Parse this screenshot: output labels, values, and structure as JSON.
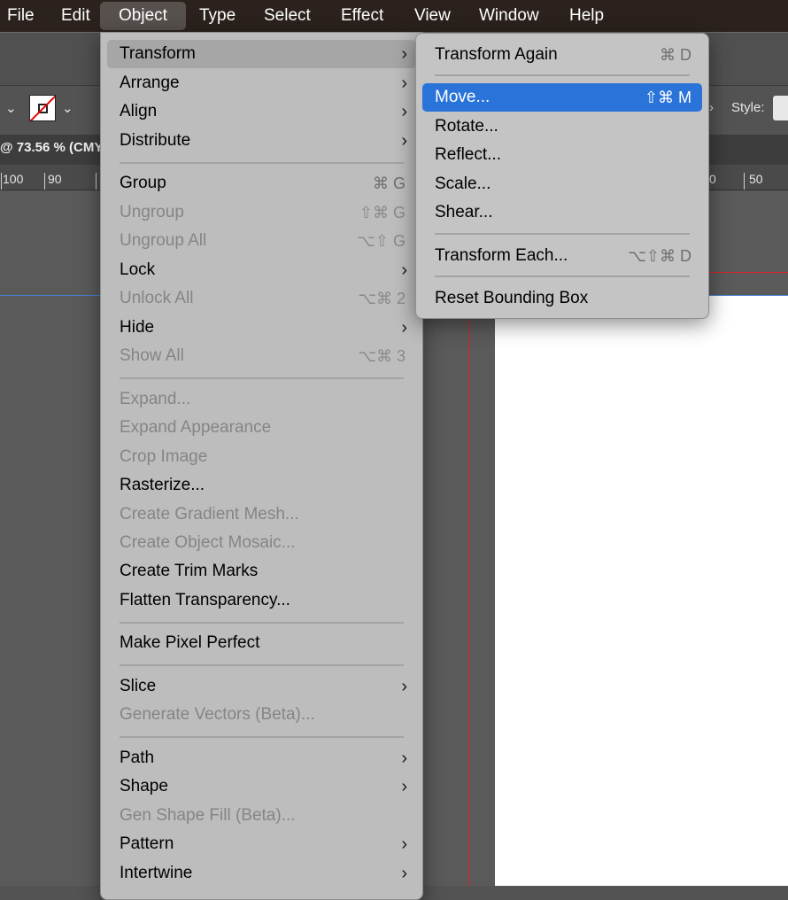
{
  "menubar": {
    "items": [
      "File",
      "Edit",
      "Object",
      "Type",
      "Select",
      "Effect",
      "View",
      "Window",
      "Help"
    ],
    "active": "Object"
  },
  "app": {
    "document_tab_title": "@ 73.56 % (CMY",
    "style_label": "Style:",
    "ruler": [
      "100",
      "90",
      "0",
      "50"
    ],
    "guide_color": "#e0202a",
    "highlight_color": "#2a73d9"
  },
  "object_menu": {
    "items": [
      {
        "label": "Transform",
        "submenu": true,
        "state": "hover"
      },
      {
        "label": "Arrange",
        "submenu": true
      },
      {
        "label": "Align",
        "submenu": true
      },
      {
        "label": "Distribute",
        "submenu": true
      },
      {
        "label": "Group",
        "shortcut": "⌘ G"
      },
      {
        "label": "Ungroup",
        "shortcut": "⇧⌘ G",
        "disabled": true
      },
      {
        "label": "Ungroup All",
        "shortcut": "⌥⇧ G",
        "disabled": true
      },
      {
        "label": "Lock",
        "submenu": true
      },
      {
        "label": "Unlock All",
        "shortcut": "⌥⌘ 2",
        "disabled": true
      },
      {
        "label": "Hide",
        "submenu": true
      },
      {
        "label": "Show All",
        "shortcut": "⌥⌘ 3",
        "disabled": true
      },
      {
        "label": "Expand...",
        "disabled": true
      },
      {
        "label": "Expand Appearance",
        "disabled": true
      },
      {
        "label": "Crop Image",
        "disabled": true
      },
      {
        "label": "Rasterize..."
      },
      {
        "label": "Create Gradient Mesh...",
        "disabled": true
      },
      {
        "label": "Create Object Mosaic...",
        "disabled": true
      },
      {
        "label": "Create Trim Marks"
      },
      {
        "label": "Flatten Transparency..."
      },
      {
        "label": "Make Pixel Perfect"
      },
      {
        "label": "Slice",
        "submenu": true
      },
      {
        "label": "Generate Vectors (Beta)...",
        "disabled": true
      },
      {
        "label": "Path",
        "submenu": true
      },
      {
        "label": "Shape",
        "submenu": true
      },
      {
        "label": "Gen Shape Fill (Beta)...",
        "disabled": true
      },
      {
        "label": "Pattern",
        "submenu": true
      },
      {
        "label": "Intertwine",
        "submenu": true
      }
    ]
  },
  "transform_submenu": {
    "items": [
      {
        "label": "Transform Again",
        "shortcut": "⌘ D"
      },
      {
        "label": "Move...",
        "shortcut": "⇧⌘ M",
        "state": "selected"
      },
      {
        "label": "Rotate..."
      },
      {
        "label": "Reflect..."
      },
      {
        "label": "Scale..."
      },
      {
        "label": "Shear..."
      },
      {
        "label": "Transform Each...",
        "shortcut": "⌥⇧⌘ D"
      },
      {
        "label": "Reset Bounding Box"
      }
    ]
  }
}
